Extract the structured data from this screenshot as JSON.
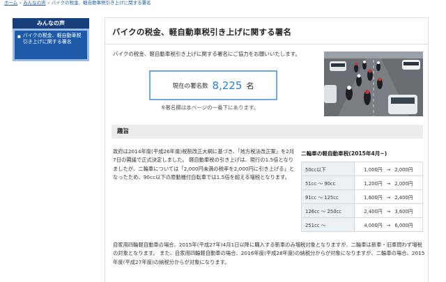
{
  "breadcrumb": {
    "home": "ホーム",
    "voices": "みんなの声",
    "current": "バイクの税金、軽自動車税引き上げに関する署名",
    "separator": "»"
  },
  "sidebar": {
    "heading": "みんなの声",
    "items": [
      {
        "label": "バイクの税金、軽自動車税引き上げに関する署名"
      }
    ]
  },
  "main": {
    "title": "バイクの税金、軽自動車税引き上げに関する署名",
    "intro": "バイクの税金、軽自動車税引き上げに関する署名にご協力をお願いいたします。",
    "count_label": "現在の署名数",
    "count_value": "8,225",
    "count_unit": "名",
    "note": "※署名欄は本ページの一番下にあります。",
    "section_title": "趣旨",
    "paragraph1": "政府は2014年度(平成26年度)税制改正大綱に基づき、「地方税法改正案」を2月7日の閣議で正式決定しました。 軽自動車税の引き上げは、現行の1.5倍となりましたが、二輪車については「2,000円未満の税率を2,000円に引き上げる」となったため、90cc以下の原動機付自転車では1.5倍を超える増税となります。",
    "paragraph2": "自家用四輪軽自動車の場合、2015年(平成27年)4月1日以降に購入する新車のみ増税対象となりますが、二輪車は新車・旧車問わず増税の対象となります。 また、自家用四輪軽自動車の場合、2016年度(平成28年度)の納税分からが対象になりますが、二輪車の場合、2015年度(平成27年度)の納税分からが対象になります。"
  },
  "tax_table": {
    "title": "二輪車の軽自動車税(2015年4月~)",
    "arrow": "→",
    "rows": [
      {
        "cat": "50cc以下",
        "old": "1,000円",
        "new": "2,000円"
      },
      {
        "cat": "51cc 〜 90cc",
        "old": "1,200円",
        "new": "2,000円"
      },
      {
        "cat": "91cc 〜 125cc",
        "old": "1,600円",
        "new": "2,400円"
      },
      {
        "cat": "126cc 〜 250cc",
        "old": "2,400円",
        "new": "3,600円"
      },
      {
        "cat": "251cc 〜",
        "old": "4,000円",
        "new": "6,000円"
      }
    ]
  },
  "colors": {
    "accent": "#2a7fd0",
    "sidebar_dark": "#163f7c",
    "sidebar_blue": "#1d5aa8",
    "border_blue": "#6fa8dc"
  },
  "photo": {
    "subject": "motorcycles riding on highway"
  }
}
